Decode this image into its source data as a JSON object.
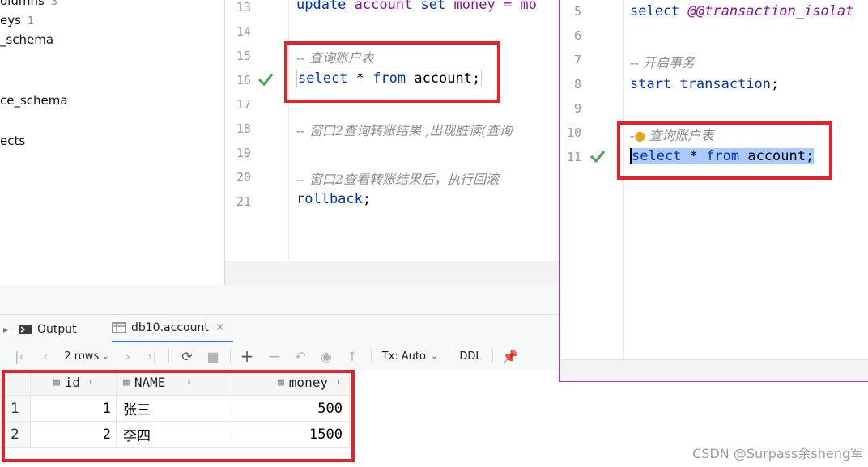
{
  "tree": {
    "items": [
      {
        "label": "olumns",
        "count": "3"
      },
      {
        "label": "eys",
        "count": "1"
      },
      {
        "label": "_schema",
        "count": ""
      },
      {
        "label": "ce_schema",
        "count": ""
      },
      {
        "label": "ects",
        "count": ""
      }
    ]
  },
  "editor1": {
    "line_numbers": [
      "13",
      "14",
      "15",
      "16",
      "17",
      "18",
      "19",
      "20",
      "21"
    ],
    "line13": {
      "kw1": "update",
      "t1": " account ",
      "kw2": "set",
      "t2": " money",
      "t3": " = mo"
    },
    "line15_comment": "-- 查询账户表",
    "line16": {
      "kw1": "select",
      "t1": " * ",
      "kw2": "from",
      "t2": " account;"
    },
    "line18_comment": "-- 窗口2查询转账结果 ,出现脏读(查询",
    "line20_comment": "-- 窗口2查看转账结果后，执行回滚",
    "line21": {
      "kw": "rollback",
      "t": ";"
    }
  },
  "editor2": {
    "line_numbers": [
      "5",
      "6",
      "7",
      "8",
      "9",
      "10",
      "11"
    ],
    "line5": {
      "kw": "select",
      "t": " @@transaction_isolat"
    },
    "line7_comment": "-- 开启事务",
    "line8": {
      "kw1": "start",
      "kw2": " transaction",
      "t": ";"
    },
    "line10_comment": "查询账户表",
    "line10_prefix": "-",
    "line11": {
      "kw1": "select",
      "t1": " * ",
      "kw2": "from",
      "t2": " account;"
    }
  },
  "tabs": {
    "output": "Output",
    "table": "db10.account"
  },
  "toolbar": {
    "rows": "2 rows",
    "tx": "Tx: Auto",
    "ddl": "DDL"
  },
  "grid": {
    "columns": [
      "id",
      "NAME",
      "money"
    ],
    "rows": [
      {
        "num": "1",
        "id": "1",
        "name": "张三",
        "money": "500"
      },
      {
        "num": "2",
        "id": "2",
        "name": "李四",
        "money": "1500"
      }
    ]
  },
  "watermark": "CSDN @Surpass余sheng军",
  "colors": {
    "highlight_box": "#e3222d",
    "keyword": "#0033b3",
    "selection": "#a9cbff",
    "window_border": "#9a3fb8"
  }
}
